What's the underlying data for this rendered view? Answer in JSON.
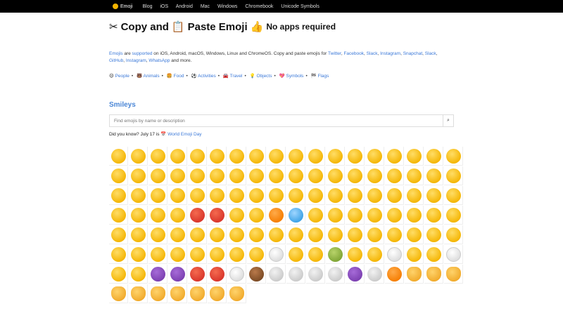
{
  "nav": {
    "brand": "Emoji",
    "items": [
      "Blog",
      "iOS",
      "Android",
      "Mac",
      "Windows",
      "Chromebook",
      "Unicode Symbols"
    ]
  },
  "header": {
    "title_part1": "Copy and",
    "title_part2": "Paste Emoji",
    "title_part3": "No apps required"
  },
  "intro": {
    "pre1": "Emojis",
    "pre2": "are",
    "pre3": "supported",
    "rest": "on iOS, Android, macOS, Windows, Linux and ChromeOS. Copy and paste emojis for",
    "platforms": [
      "Twitter",
      "Facebook",
      "Slack",
      "Instagram",
      "Snapchat",
      "Slack",
      "GitHub",
      "Instagram",
      "WhatsApp"
    ],
    "tail": "and more."
  },
  "categories": [
    "People",
    "Animals",
    "Food",
    "Activities",
    "Travel",
    "Objects",
    "Symbols",
    "Flags"
  ],
  "section": {
    "title": "Smileys",
    "search_placeholder": "Find emojis by name or description",
    "dyk_pre": "Did you know? July 17 is",
    "dyk_link": "World Emoji Day"
  },
  "grid_colors": [
    "y",
    "y",
    "y",
    "y",
    "y",
    "y",
    "y",
    "y",
    "y",
    "y",
    "y",
    "y",
    "y",
    "y",
    "y",
    "y",
    "y",
    "y",
    "y",
    "y",
    "y",
    "y",
    "y",
    "y",
    "y",
    "y",
    "y",
    "y",
    "y",
    "y",
    "y",
    "y",
    "y",
    "y",
    "y",
    "y",
    "y",
    "y",
    "y",
    "y",
    "y",
    "y",
    "y",
    "y",
    "y",
    "y",
    "y",
    "y",
    "y",
    "y",
    "y",
    "y",
    "y",
    "y",
    "y",
    "y",
    "y",
    "y",
    "red",
    "red",
    "y",
    "y",
    "orange",
    "blue",
    "y",
    "y",
    "y",
    "y",
    "y",
    "y",
    "y",
    "y",
    "y",
    "y",
    "y",
    "y",
    "y",
    "y",
    "y",
    "y",
    "y",
    "y",
    "y",
    "y",
    "y",
    "y",
    "y",
    "y",
    "y",
    "y",
    "y",
    "y",
    "y",
    "y",
    "y",
    "y",
    "y",
    "y",
    "white",
    "y",
    "y",
    "green",
    "y",
    "y",
    "white",
    "y",
    "y",
    "white",
    "y",
    "y",
    "purple",
    "purple",
    "red",
    "red",
    "white",
    "brown",
    "grey",
    "grey",
    "grey",
    "grey",
    "purple",
    "grey",
    "orange",
    "cat",
    "cat",
    "cat",
    "cat",
    "cat",
    "cat",
    "cat",
    "cat",
    "cat",
    "cat"
  ]
}
